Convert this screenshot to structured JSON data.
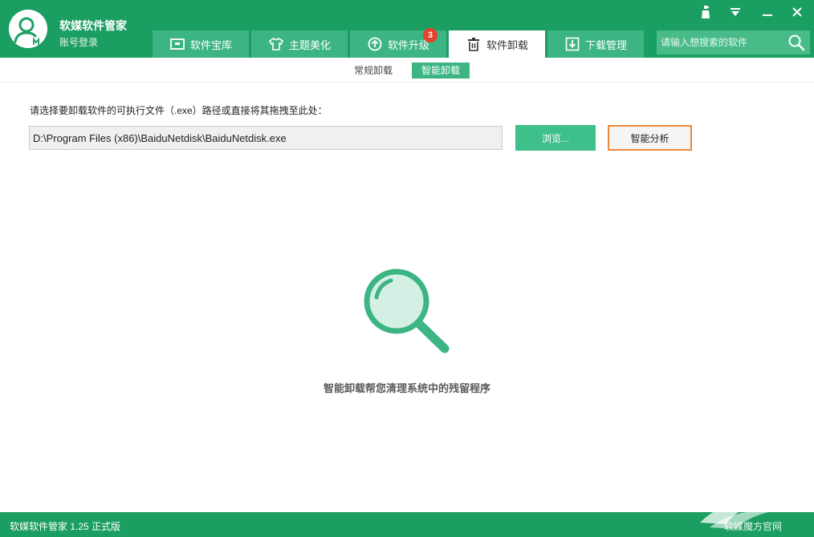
{
  "header": {
    "app_title": "软媒软件管家",
    "login_label": "账号登录",
    "tabs": [
      {
        "label": "软件宝库",
        "icon": "box-icon"
      },
      {
        "label": "主题美化",
        "icon": "tshirt-icon"
      },
      {
        "label": "软件升级",
        "icon": "upgrade-icon",
        "badge": "3"
      },
      {
        "label": "软件卸载",
        "icon": "trash-icon",
        "active": true
      },
      {
        "label": "下载管理",
        "icon": "download-icon"
      }
    ],
    "search": {
      "placeholder": "请输入想搜索的软件"
    }
  },
  "subtabs": {
    "normal_uninstall": "常规卸载",
    "smart_uninstall": "智能卸载",
    "active": "智能卸载"
  },
  "main": {
    "instruction": "请选择要卸载软件的可执行文件（.exe）路径或直接将其拖拽至此处：",
    "path_value": "D:\\Program Files (x86)\\BaiduNetdisk\\BaiduNetdisk.exe",
    "browse_label": "浏览...",
    "analyze_label": "智能分析",
    "hint": "智能卸载帮您清理系统中的残留程序"
  },
  "footer": {
    "version": "软媒软件管家 1.25 正式版",
    "official_site": "软媒魔方官网"
  },
  "colors": {
    "brand_green": "#1b9e61",
    "tab_green": "#3db583",
    "badge_red": "#e6402f",
    "highlight_orange": "#f0883a"
  }
}
